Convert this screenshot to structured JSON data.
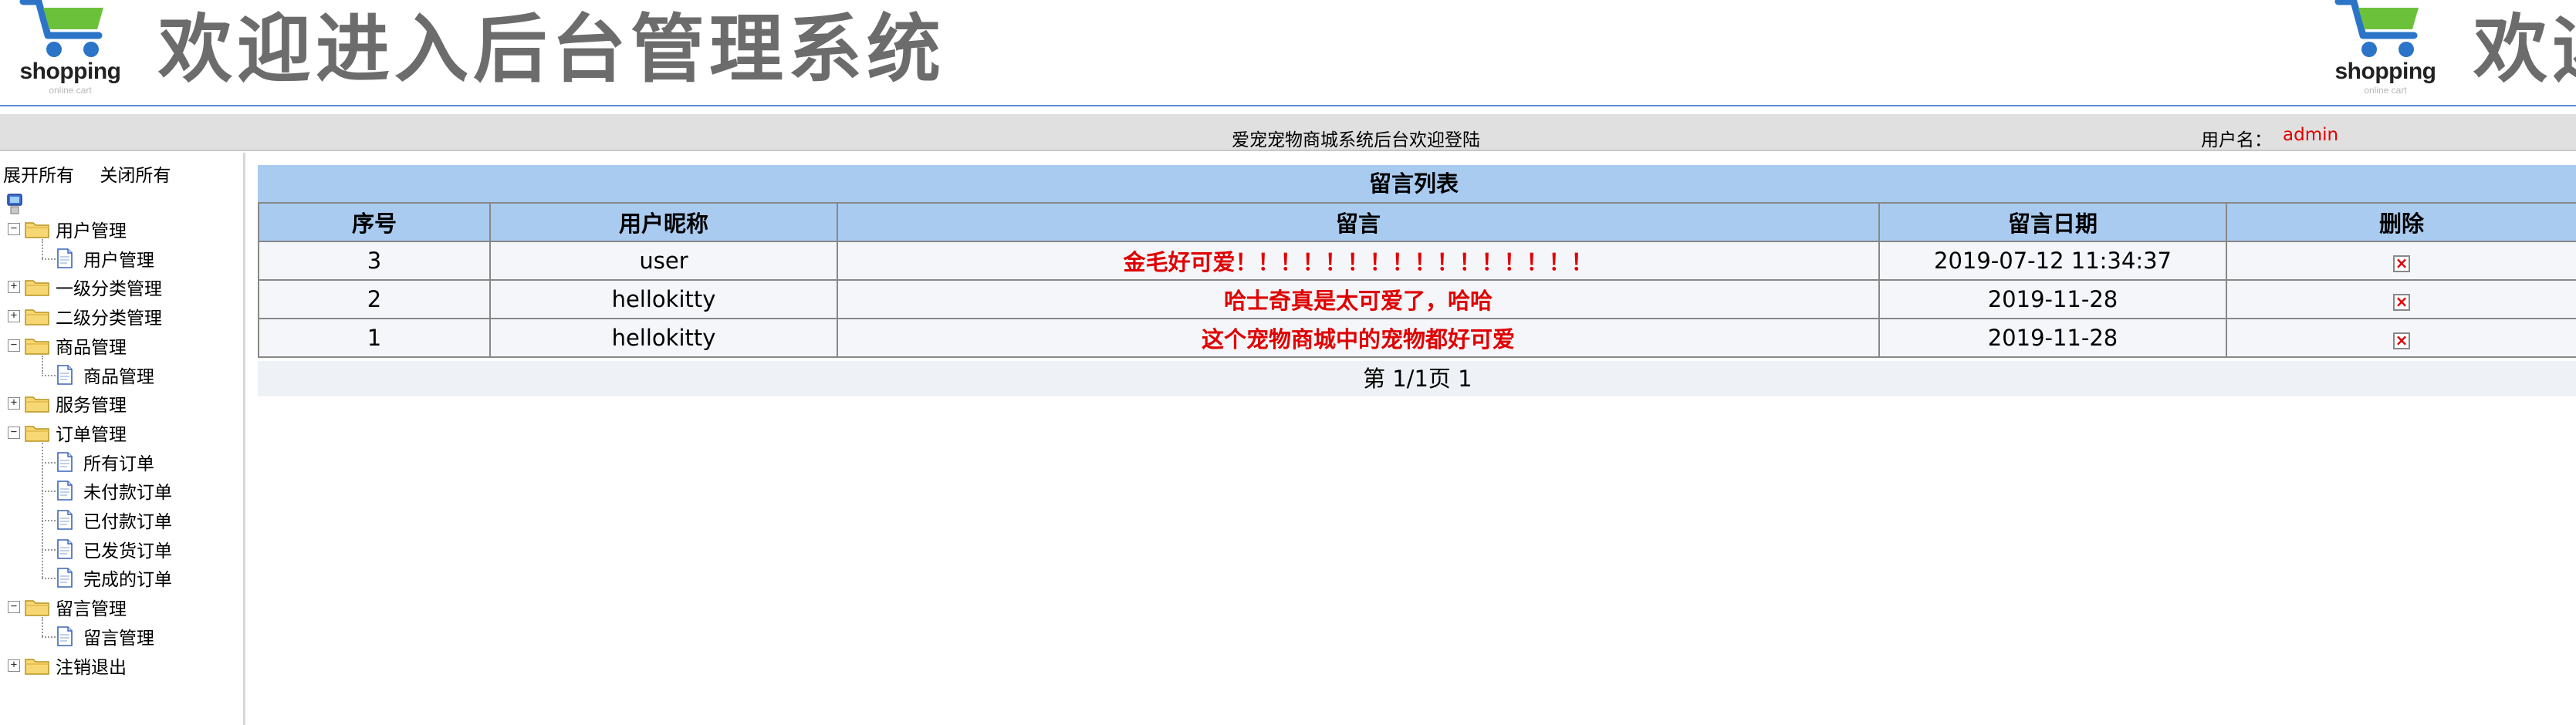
{
  "banner": {
    "logo_word": "shopping",
    "logo_sub": "online cart",
    "title": "欢迎进入后台管理系统"
  },
  "topbar": {
    "welcome": "爱宠宠物商城系统后台欢迎登陆",
    "user_label": "用户名：",
    "user_name": "admin"
  },
  "sidebar": {
    "expand_all": "展开所有",
    "collapse_all": "关闭所有",
    "tree": [
      {
        "label": "用户管理",
        "expanded": true,
        "children": [
          "用户管理"
        ]
      },
      {
        "label": "一级分类管理",
        "expanded": false,
        "children": []
      },
      {
        "label": "二级分类管理",
        "expanded": false,
        "children": []
      },
      {
        "label": "商品管理",
        "expanded": true,
        "children": [
          "商品管理"
        ]
      },
      {
        "label": "服务管理",
        "expanded": false,
        "children": []
      },
      {
        "label": "订单管理",
        "expanded": true,
        "children": [
          "所有订单",
          "未付款订单",
          "已付款订单",
          "已发货订单",
          "完成的订单"
        ]
      },
      {
        "label": "留言管理",
        "expanded": true,
        "children": [
          "留言管理"
        ]
      },
      {
        "label": "注销退出",
        "expanded": false,
        "children": []
      }
    ]
  },
  "main": {
    "list_title": "留言列表",
    "columns": [
      "序号",
      "用户昵称",
      "留言",
      "留言日期",
      "删除"
    ],
    "rows": [
      {
        "id": "3",
        "nickname": "user",
        "message": "金毛好可爱！！！！！！！！！！！！！！！！",
        "date": "2019-07-12 11:34:37"
      },
      {
        "id": "2",
        "nickname": "hellokitty",
        "message": "哈士奇真是太可爱了，哈哈",
        "date": "2019-11-28"
      },
      {
        "id": "1",
        "nickname": "hellokitty",
        "message": "这个宠物商城中的宠物都好可爱",
        "date": "2019-11-28"
      }
    ],
    "pager": "第 1/1页 1"
  },
  "colors": {
    "banner_line": "#5b8ed8",
    "table_header": "#a9cbf0",
    "alert_red": "#e00000"
  }
}
